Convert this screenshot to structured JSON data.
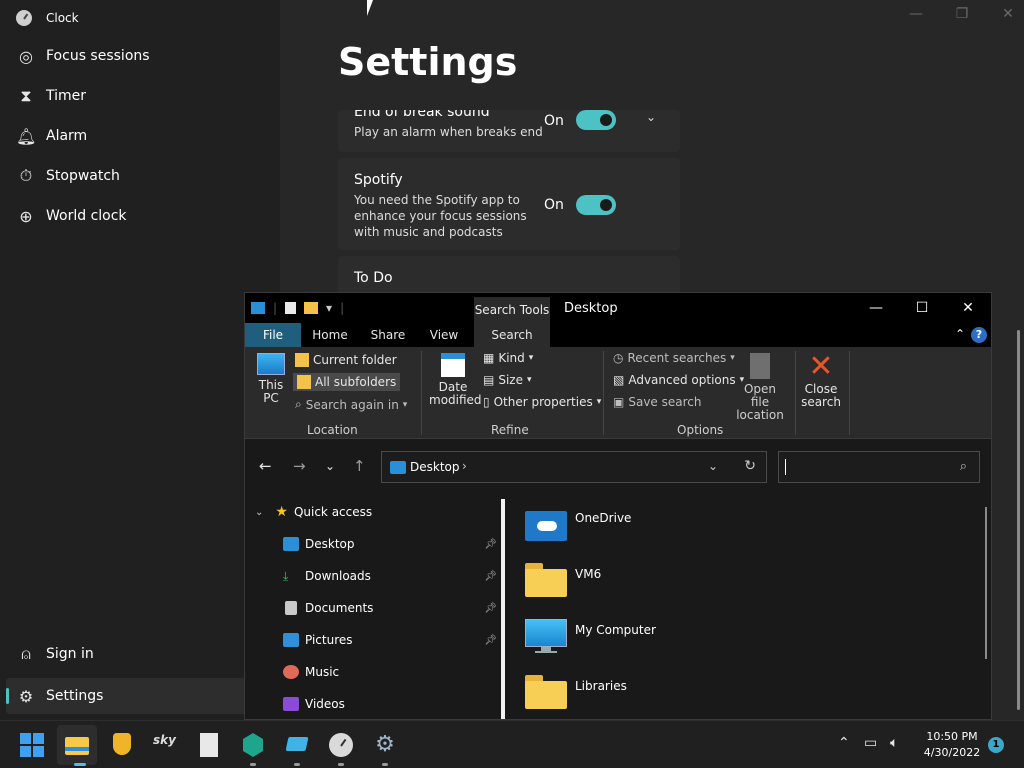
{
  "clock": {
    "app_title": "Clock",
    "nav": [
      {
        "label": "Focus sessions",
        "icon": "focus-icon"
      },
      {
        "label": "Timer",
        "icon": "hourglass-icon"
      },
      {
        "label": "Alarm",
        "icon": "bell-icon"
      },
      {
        "label": "Stopwatch",
        "icon": "stopwatch-icon"
      },
      {
        "label": "World clock",
        "icon": "globe-icon"
      }
    ],
    "bottom_nav": [
      {
        "label": "Sign in",
        "icon": "person-icon"
      },
      {
        "label": "Settings",
        "icon": "gear-icon"
      }
    ],
    "page_title": "Settings",
    "cards": [
      {
        "title": "End of break sound",
        "desc": "Play an alarm when breaks end",
        "state": "On"
      },
      {
        "title": "Spotify",
        "desc": "You need the Spotify app to enhance your focus sessions with music and podcasts",
        "state": "On"
      },
      {
        "title": "To Do",
        "desc": "",
        "state": ""
      }
    ],
    "accent": "#4cc2c4"
  },
  "explorer": {
    "title": "Desktop",
    "contextual_tab": "Search Tools",
    "tabs": [
      "File",
      "Home",
      "Share",
      "View",
      "Search"
    ],
    "active_tab": "Search",
    "ribbon": {
      "this_pc_label": "This PC",
      "current_folder": "Current folder",
      "all_subfolders": "All subfolders",
      "search_again": "Search again in",
      "location_group": "Location",
      "date_modified": "Date modified",
      "kind": "Kind",
      "size": "Size",
      "other_properties": "Other properties",
      "refine_group": "Refine",
      "recent_searches": "Recent searches",
      "advanced_options": "Advanced options",
      "save_search": "Save search",
      "open_file_location": "Open file location",
      "close_search": "Close search",
      "options_group": "Options"
    },
    "address": {
      "location": "Desktop"
    },
    "search": {
      "value": ""
    },
    "tree": [
      {
        "label": "Quick access",
        "icon": "star-icon",
        "pinned": false,
        "level": 0
      },
      {
        "label": "Desktop",
        "icon": "desktop-icon",
        "pinned": true,
        "level": 1
      },
      {
        "label": "Downloads",
        "icon": "download-icon",
        "pinned": true,
        "level": 1
      },
      {
        "label": "Documents",
        "icon": "documents-icon",
        "pinned": true,
        "level": 1
      },
      {
        "label": "Pictures",
        "icon": "pictures-icon",
        "pinned": true,
        "level": 1
      },
      {
        "label": "Music",
        "icon": "music-icon",
        "pinned": false,
        "level": 1
      },
      {
        "label": "Videos",
        "icon": "videos-icon",
        "pinned": false,
        "level": 1
      }
    ],
    "items": [
      {
        "name": "OneDrive",
        "icon": "onedrive-folder-icon"
      },
      {
        "name": "VM6",
        "icon": "folder-icon"
      },
      {
        "name": "My Computer",
        "icon": "computer-icon"
      },
      {
        "name": "Libraries",
        "icon": "folder-icon"
      }
    ]
  },
  "taskbar": {
    "time": "10:50 PM",
    "date": "4/30/2022",
    "notifications": "1"
  }
}
